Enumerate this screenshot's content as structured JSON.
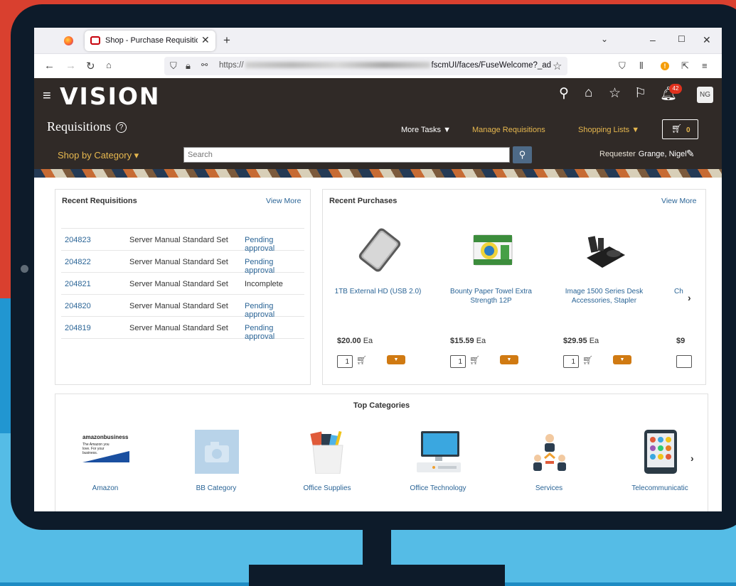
{
  "browser": {
    "tab_title": "Shop - Purchase Requisitions - ",
    "tab_close": "✕",
    "new_tab": "+",
    "url_prefix": "https://",
    "url_suffix": "fscmUI/faces/FuseWelcome?_ad",
    "notification_count": "!"
  },
  "header": {
    "logo": "VISION",
    "badge_count": "42",
    "avatar_initials": "NG",
    "page_title": "Requisitions",
    "help": "?",
    "more_tasks": "More Tasks ▼",
    "manage_requisitions": "Manage Requisitions",
    "shopping_lists": "Shopping Lists ▼",
    "cart_count": "0",
    "shop_by_category": "Shop by Category ▾",
    "search_placeholder": "Search",
    "requester_label": "Requester",
    "requester_name": "Grange, Nigel"
  },
  "recent_requisitions": {
    "title": "Recent Requisitions",
    "view_more": "View More",
    "rows": [
      {
        "id": "204823",
        "description": "Server Manual Standard Set",
        "status": "Pending approval",
        "status_type": "link"
      },
      {
        "id": "204822",
        "description": "Server Manual Standard Set",
        "status": "Pending approval",
        "status_type": "link"
      },
      {
        "id": "204821",
        "description": "Server Manual Standard Set",
        "status": "Incomplete",
        "status_type": "text"
      },
      {
        "id": "204820",
        "description": "Server Manual Standard Set",
        "status": "Pending approval",
        "status_type": "link"
      },
      {
        "id": "204819",
        "description": "Server Manual Standard Set",
        "status": "Pending approval",
        "status_type": "link"
      }
    ]
  },
  "recent_purchases": {
    "title": "Recent Purchases",
    "view_more": "View More",
    "items": [
      {
        "name": "1TB External HD (USB 2.0)",
        "price": "$20.00",
        "unit": "Ea",
        "qty": "1"
      },
      {
        "name": "Bounty Paper Towel Extra Strength 12P",
        "price": "$15.59",
        "unit": "Ea",
        "qty": "1"
      },
      {
        "name": "Image 1500 Series Desk Accessories, Stapler",
        "price": "$29.95",
        "unit": "Ea",
        "qty": "1"
      },
      {
        "name": "Ch",
        "price": "$9",
        "unit": "",
        "qty": ""
      }
    ]
  },
  "top_categories": {
    "title": "Top Categories",
    "amazon_logo_text": "amazonbusiness",
    "amazon_tagline": "The Amazon you love. For your business.",
    "items": [
      {
        "label": "Amazon",
        "icon": "amazon-business-logo"
      },
      {
        "label": "BB Category",
        "icon": "camera-placeholder-icon"
      },
      {
        "label": "Office Supplies",
        "icon": "office-supplies-icon"
      },
      {
        "label": "Office Technology",
        "icon": "computer-icon"
      },
      {
        "label": "Services",
        "icon": "people-network-icon"
      },
      {
        "label": "Telecommunicatic",
        "icon": "tablet-icon"
      }
    ]
  },
  "colors": {
    "header_bg": "#302a27",
    "accent_gold": "#e7b84f",
    "link_blue": "#2a6496",
    "add_button": "#d07a12"
  }
}
